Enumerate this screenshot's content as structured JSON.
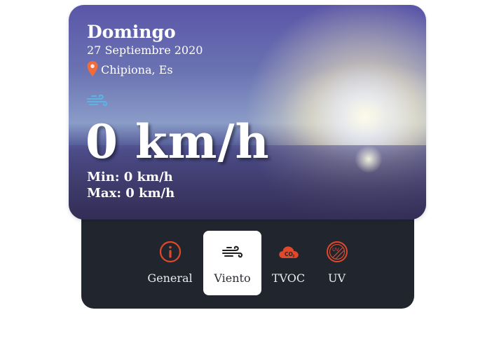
{
  "weather": {
    "day": "Domingo",
    "date": "27 Septiembre 2020",
    "location": "Chipiona, Es",
    "value": "0 km/h",
    "min": "Min: 0 km/h",
    "max": "Max: 0 km/h"
  },
  "tabs": [
    {
      "label": "General",
      "icon": "info-icon",
      "active": false
    },
    {
      "label": "Viento",
      "icon": "wind-icon",
      "active": true
    },
    {
      "label": "TVOC",
      "icon": "co2-cloud-icon",
      "active": false
    },
    {
      "label": "UV",
      "icon": "uv-icon",
      "active": false
    }
  ],
  "colors": {
    "accent": "#e0482a",
    "panel": "#21252e",
    "wind_icon": "#5ab4e6",
    "pin": "#f26b3a"
  }
}
